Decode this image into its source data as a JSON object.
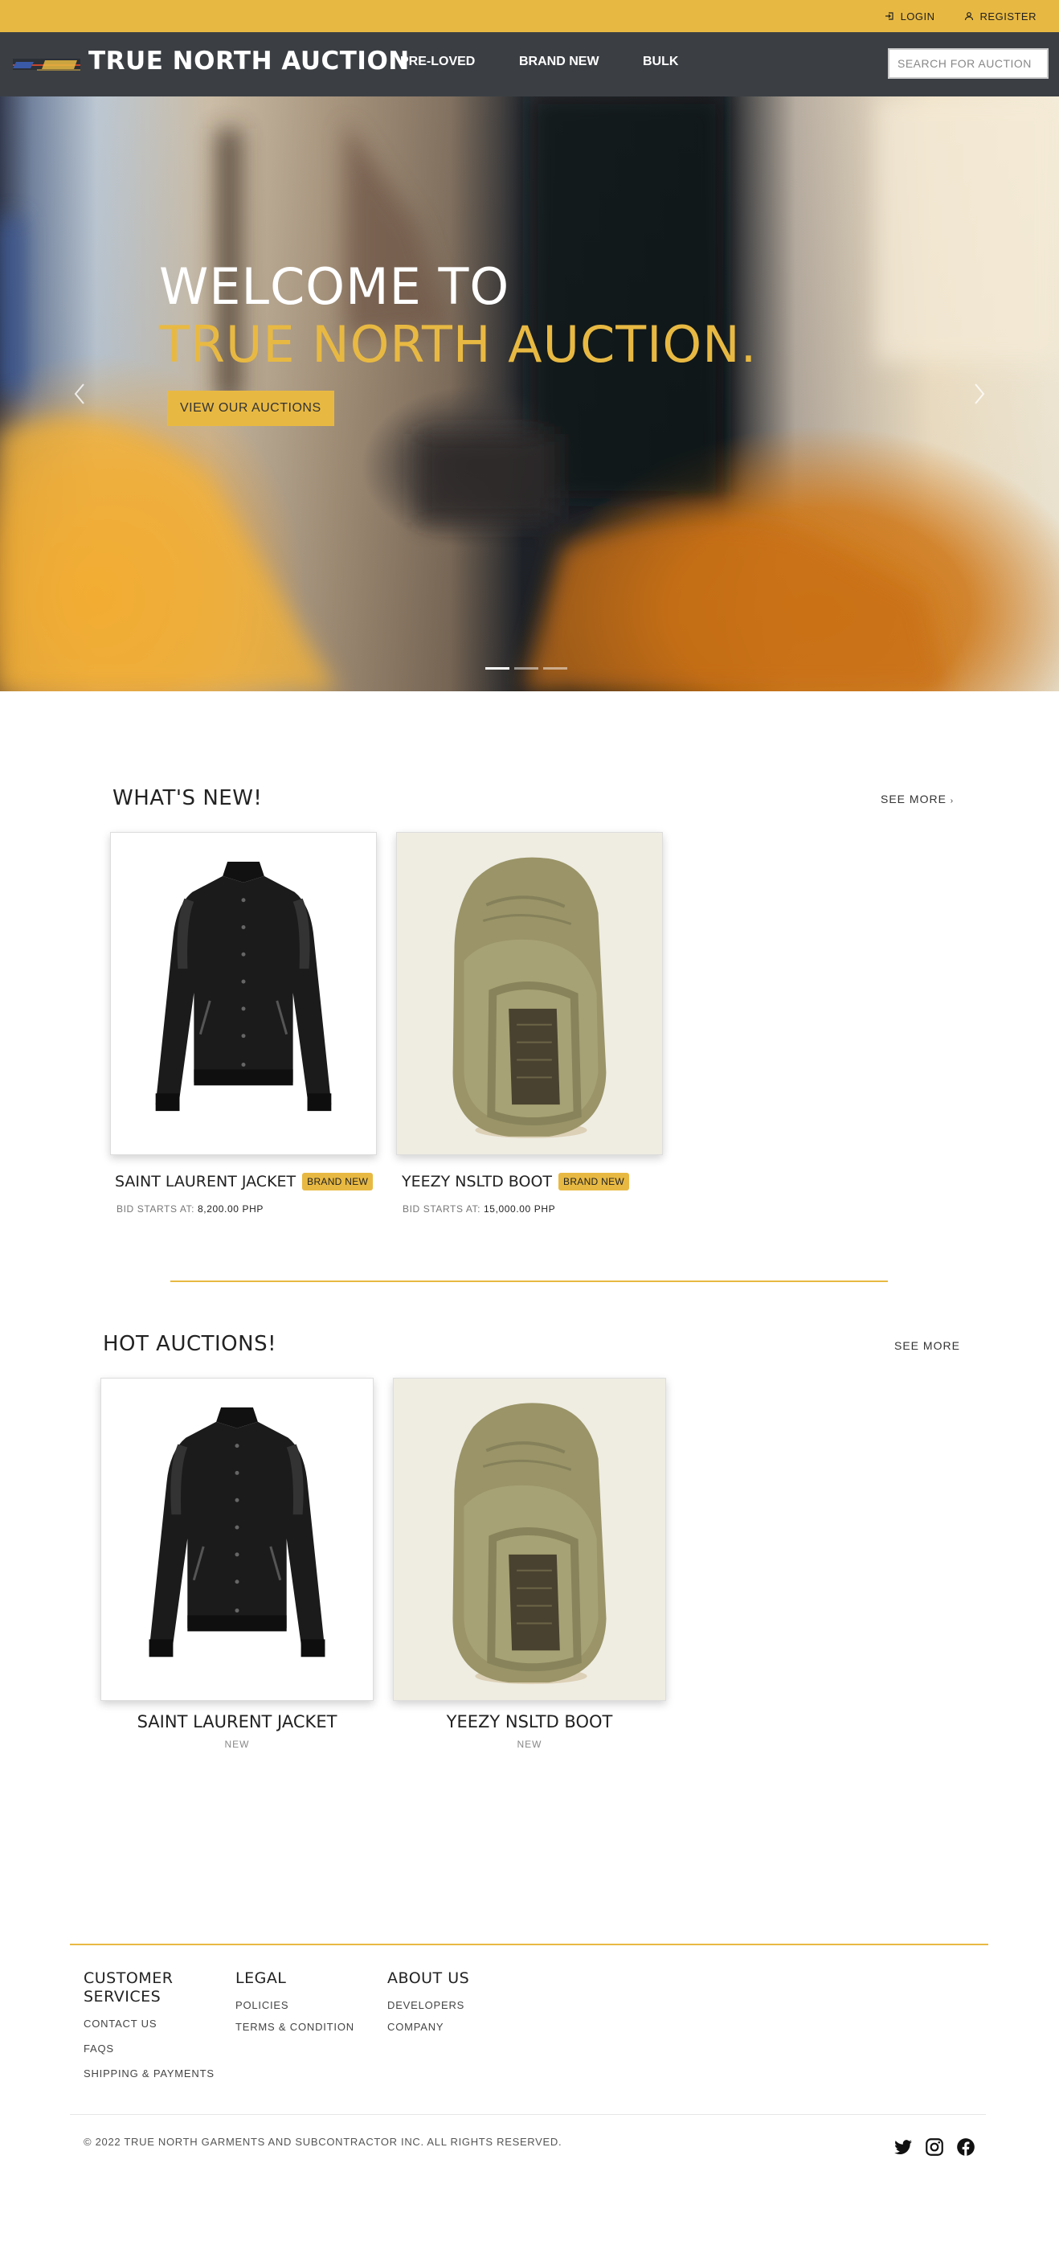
{
  "topbar": {
    "login": "LOGIN",
    "register": "REGISTER"
  },
  "nav": {
    "brand": "TRUE NORTH AUCTION",
    "links": [
      "PRE-LOVED",
      "BRAND NEW",
      "BULK"
    ],
    "search_placeholder": "SEARCH FOR AUCTION"
  },
  "hero": {
    "title_line1": "WELCOME TO",
    "title_line2": "TRUE NORTH AUCTION.",
    "cta": "VIEW OUR AUCTIONS",
    "slides": 3,
    "active_slide": 1
  },
  "whats_new": {
    "title": "WHAT'S NEW!",
    "see_more": "SEE MORE",
    "items": [
      {
        "name": "SAINT LAURENT JACKET",
        "badge": "BRAND NEW",
        "bid_label": "BID STARTS AT:",
        "bid_value": "8,200.00 PHP",
        "image": "black-varsity-jacket"
      },
      {
        "name": "YEEZY NSLTD BOOT",
        "badge": "BRAND NEW",
        "bid_label": "BID STARTS AT:",
        "bid_value": "15,000.00 PHP",
        "image": "khaki-knit-boot"
      }
    ]
  },
  "hot_auctions": {
    "title": "HOT AUCTIONS!",
    "see_more": "SEE MORE",
    "items": [
      {
        "name": "SAINT LAURENT JACKET",
        "condition": "NEW",
        "image": "black-varsity-jacket"
      },
      {
        "name": "YEEZY NSLTD BOOT",
        "condition": "NEW",
        "image": "khaki-knit-boot"
      }
    ]
  },
  "footer": {
    "columns": [
      {
        "heading": "CUSTOMER SERVICES",
        "links": [
          "CONTACT US",
          "FAQS",
          "SHIPPING & PAYMENTS"
        ]
      },
      {
        "heading": "LEGAL",
        "links": [
          "POLICIES",
          "TERMS & CONDITION"
        ]
      },
      {
        "heading": "ABOUT US",
        "links": [
          "DEVELOPERS",
          "COMPANY"
        ]
      }
    ],
    "copyright": "© 2022 TRUE NORTH GARMENTS AND SUBCONTRACTOR INC. ALL RIGHTS RESERVED.",
    "social": [
      "twitter-icon",
      "instagram-icon",
      "facebook-icon"
    ]
  },
  "colors": {
    "accent": "#e8b942",
    "nav_bg": "#3b3f44"
  }
}
